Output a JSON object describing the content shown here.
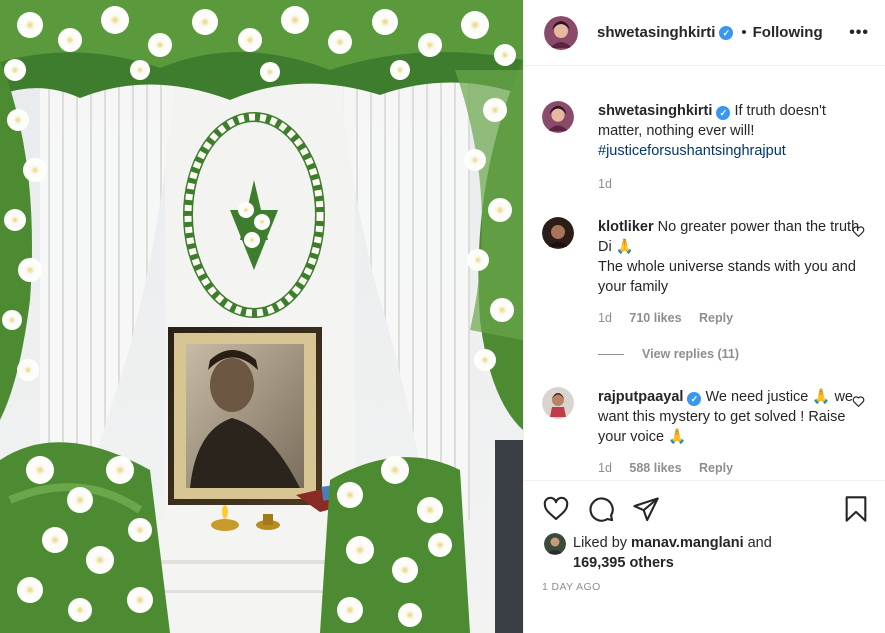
{
  "post": {
    "username": "shwetasinghkirti",
    "separator": "•",
    "follow_state": "Following",
    "more_label": "•••"
  },
  "caption": {
    "username": "shwetasinghkirti",
    "text": " If truth doesn't matter, nothing ever will!",
    "hashtag": "#justiceforsushantsinghrajput",
    "age": "1d"
  },
  "comments": [
    {
      "username": "klotliker",
      "text": " No greater power than the truth Di 🙏",
      "text2": "The whole universe stands with you and your family",
      "age": "1d",
      "likes": "710 likes",
      "reply": "Reply",
      "view_replies": "View replies (11)"
    },
    {
      "username": "rajputpaayal",
      "text": " We need justice 🙏 we want this mystery to get solved ! Raise your voice 🙏",
      "age": "1d",
      "likes": "588 likes",
      "reply": "Reply"
    }
  ],
  "actions": {
    "liked_prefix": "Liked by ",
    "liked_user": "manav.manglani",
    "liked_and": " and",
    "others": "169,395 others",
    "date": "1 DAY AGO"
  },
  "icons": [
    "heart-icon",
    "comment-icon",
    "share-icon",
    "bookmark-icon",
    "verified-icon",
    "more-icon"
  ],
  "colors": {
    "link": "#00376b",
    "verified": "#3897f0",
    "muted": "#8e8e8e",
    "text": "#262626"
  }
}
